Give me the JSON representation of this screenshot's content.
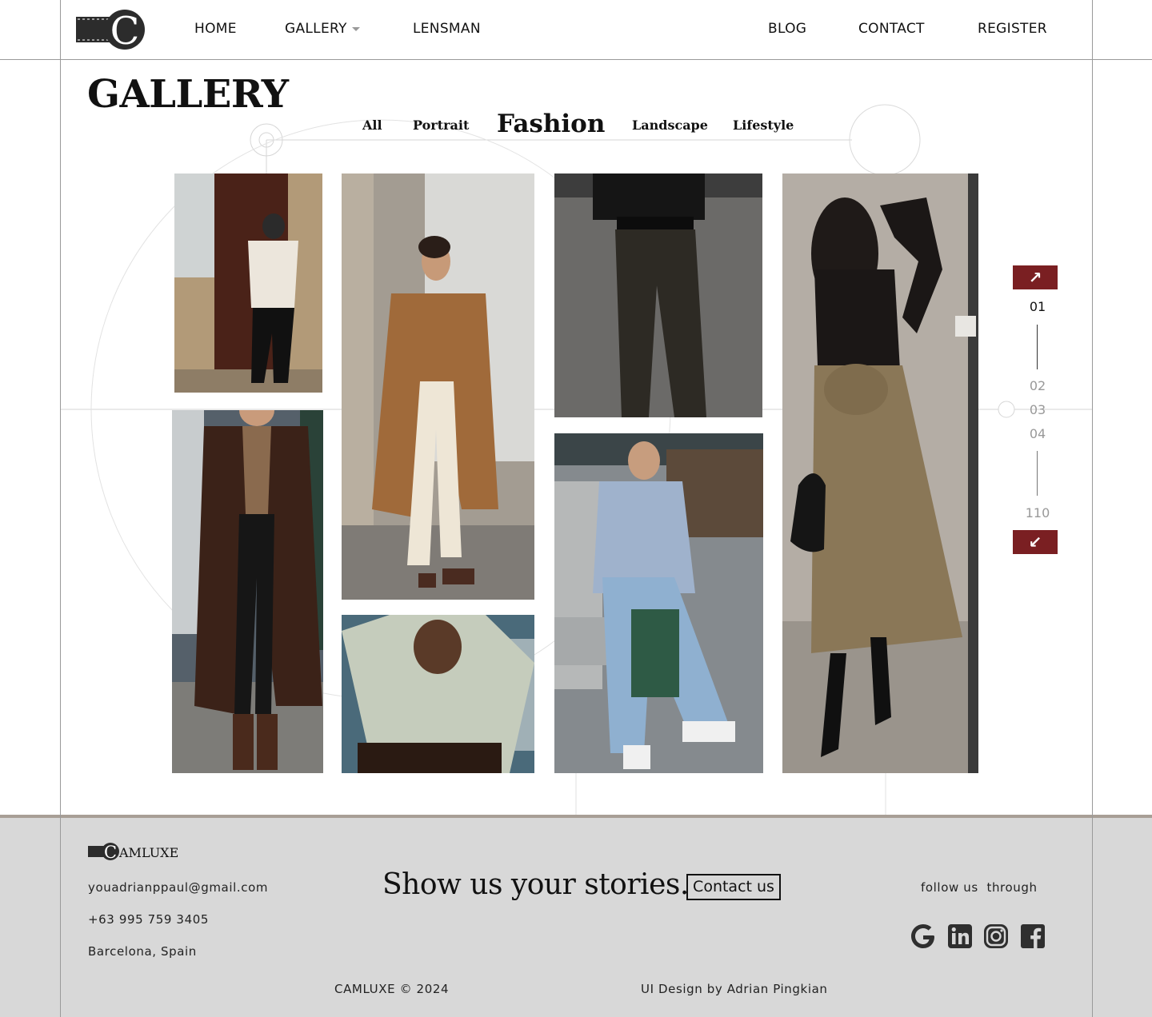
{
  "nav": {
    "home": "HOME",
    "gallery": "GALLERY",
    "lensman": "LENSMAN",
    "blog": "BLOG",
    "contact": "CONTACT",
    "register": "REGISTER"
  },
  "page_title": "GALLERY",
  "filters": [
    "All",
    "Portrait",
    "Fashion",
    "Landscape",
    "Lifestyle"
  ],
  "active_filter": "Fashion",
  "photos": [
    {
      "subject": "man in cream sweater and black trousers"
    },
    {
      "subject": "man in long camel coat and white trousers"
    },
    {
      "subject": "black trousers close-up"
    },
    {
      "subject": "woman in black top and khaki skirt"
    },
    {
      "subject": "man in long brown coat"
    },
    {
      "subject": "man in knit polo sweater"
    },
    {
      "subject": "man in blue sweater and jeans sitting"
    }
  ],
  "pager": {
    "up_icon": "arrow-up-icon",
    "down_icon": "arrow-down-icon",
    "current": "01",
    "pages": [
      "02",
      "03",
      "04"
    ],
    "last": "110"
  },
  "footer": {
    "brand": "AMLUXE",
    "email": "youadrianppaul@gmail.com",
    "phone": "+63 995 759 3405",
    "location": "Barcelona, Spain",
    "tagline": "Show us your stories.",
    "contact_button": "Contact us",
    "follow": "follow us  through",
    "socials": [
      "google-icon",
      "linkedin-icon",
      "instagram-icon",
      "facebook-icon"
    ],
    "copyright": "CAMLUXE © 2024",
    "credit": "UI Design by Adrian Pingkian"
  },
  "colors": {
    "accent": "#7a1f22",
    "footer_bg": "#d8d8d8",
    "footer_border": "#a89f96"
  }
}
